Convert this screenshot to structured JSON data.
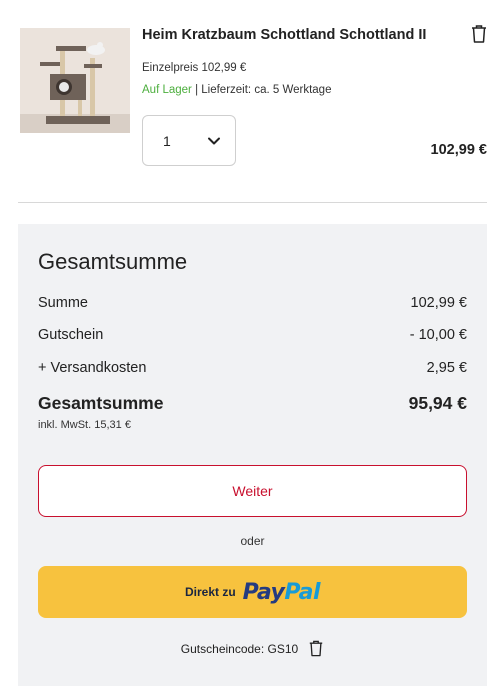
{
  "cart_item": {
    "title": "Heim Kratzbaum Schottland Schottland II",
    "unit_price_label": "Einzelpreis",
    "unit_price": "102,99 €",
    "stock_status": "Auf Lager",
    "delivery_label": "| Lieferzeit:",
    "delivery_time": "ca. 5 Werktage",
    "quantity": "1",
    "line_total": "102,99 €",
    "icons": {
      "remove": "trash-icon",
      "quantity_toggle": "chevron-down-icon"
    }
  },
  "summary": {
    "title": "Gesamtsumme",
    "rows": [
      {
        "label": "Summe",
        "value": "102,99 €"
      },
      {
        "label": "Gutschein",
        "value": "- 10,00 €"
      },
      {
        "label": "+ Versandkosten",
        "value": "2,95 €"
      }
    ],
    "total_label": "Gesamtsumme",
    "total_value": "95,94 €",
    "vat_note": "inkl. MwSt. 15,31 €",
    "continue_label": "Weiter",
    "or_label": "oder",
    "paypal_prefix": "Direkt zu",
    "paypal_word_1": "Pay",
    "paypal_word_2": "Pal",
    "voucher_label": "Gutscheincode: GS10"
  },
  "colors": {
    "accent_red": "#c8102e",
    "in_stock_green": "#4cae3d",
    "paypal_yellow": "#f7c23e",
    "paypal_dark_blue": "#253b80",
    "paypal_light_blue": "#179bd7",
    "summary_bg": "#f1f2f4"
  }
}
